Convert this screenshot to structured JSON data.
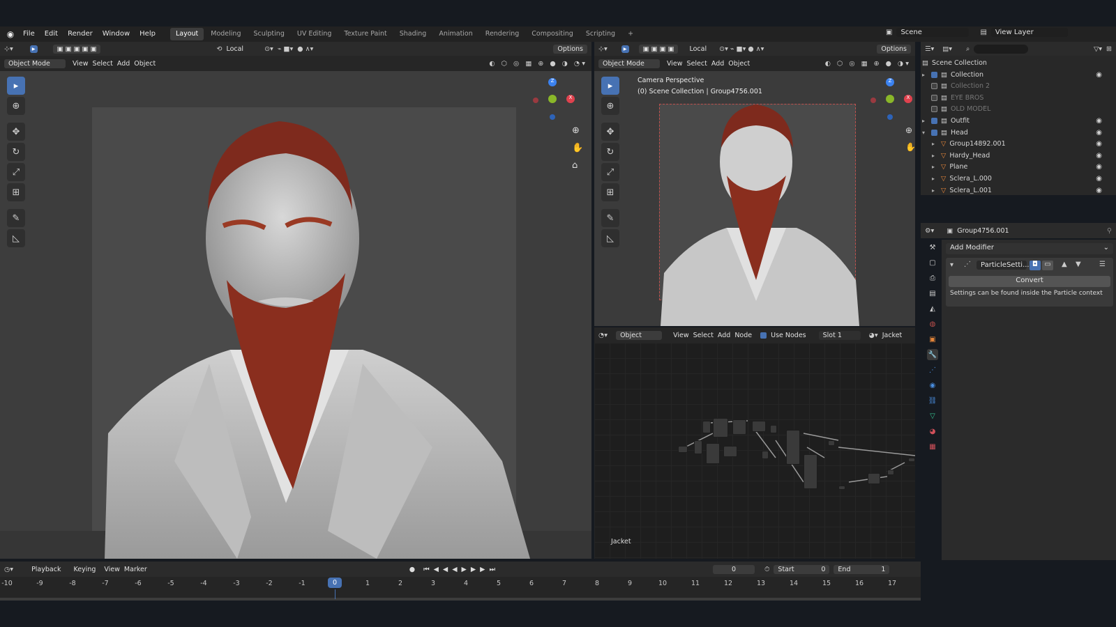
{
  "menu": {
    "file": "File",
    "edit": "Edit",
    "render": "Render",
    "window": "Window",
    "help": "Help"
  },
  "workspaces": [
    "Layout",
    "Modeling",
    "Sculpting",
    "UV Editing",
    "Texture Paint",
    "Shading",
    "Animation",
    "Rendering",
    "Compositing",
    "Scripting"
  ],
  "scene": {
    "label": "Scene",
    "view_layer": "View Layer"
  },
  "viewport_header": {
    "transform": "Local",
    "options": "Options"
  },
  "viewport_left": {
    "mode": "Object Mode",
    "view": "View",
    "select": "Select",
    "add": "Add",
    "object": "Object"
  },
  "viewport_right": {
    "mode": "Object Mode",
    "view": "View",
    "select": "Select",
    "add": "Add",
    "object": "Object",
    "transform": "Local",
    "options": "Options",
    "camera_title": "Camera Perspective",
    "camera_sub": "(0) Scene Collection | Group4756.001"
  },
  "node_editor": {
    "type": "Object",
    "view": "View",
    "select": "Select",
    "add": "Add",
    "node": "Node",
    "use_nodes": "Use Nodes",
    "slot": "Slot 1",
    "material": "Jacket",
    "footer_label": "Jacket"
  },
  "outliner": {
    "root": "Scene Collection",
    "rows": [
      {
        "name": "Collection",
        "checked": true,
        "dim": false,
        "indent": 0,
        "expander": "▸"
      },
      {
        "name": "Collection 2",
        "checked": false,
        "dim": true,
        "indent": 0,
        "expander": ""
      },
      {
        "name": "EYE BROS",
        "checked": false,
        "dim": true,
        "indent": 0,
        "expander": ""
      },
      {
        "name": "OLD MODEL",
        "checked": false,
        "dim": true,
        "indent": 0,
        "expander": ""
      },
      {
        "name": "Outfit",
        "checked": true,
        "dim": false,
        "indent": 0,
        "expander": "▸"
      },
      {
        "name": "Head",
        "checked": true,
        "dim": false,
        "indent": 0,
        "expander": "▾"
      },
      {
        "name": "Group14892.001",
        "checked": null,
        "dim": false,
        "indent": 1,
        "expander": "▸"
      },
      {
        "name": "Hardy_Head",
        "checked": null,
        "dim": false,
        "indent": 1,
        "expander": "▸"
      },
      {
        "name": "Plane",
        "checked": null,
        "dim": false,
        "indent": 1,
        "expander": "▸"
      },
      {
        "name": "Sclera_L.000",
        "checked": null,
        "dim": false,
        "indent": 1,
        "expander": "▸"
      },
      {
        "name": "Sclera_L.001",
        "checked": null,
        "dim": false,
        "indent": 1,
        "expander": "▸"
      }
    ]
  },
  "properties": {
    "object_name": "Group4756.001",
    "add_modifier": "Add Modifier",
    "modifier_name": "ParticleSetti...",
    "convert": "Convert",
    "info": "Settings can be found inside the Particle context"
  },
  "timeline": {
    "playback": "Playback",
    "keying": "Keying",
    "view": "View",
    "marker": "Marker",
    "current_frame": "0",
    "start_label": "Start",
    "start": "0",
    "end_label": "End",
    "end": "1"
  },
  "ruler_ticks": [
    "-10",
    "-9",
    "-8",
    "-7",
    "-6",
    "-5",
    "-4",
    "-3",
    "-2",
    "-1",
    "0",
    "1",
    "2",
    "3",
    "4",
    "5",
    "6",
    "7",
    "8",
    "9",
    "10",
    "11",
    "12",
    "13",
    "14",
    "15",
    "16",
    "17"
  ],
  "colors": {
    "accent": "#4772b3",
    "header": "#2b2b2b",
    "viewport": "#3a3a3a",
    "hair": "#8a2e1e",
    "x_axis": "#e0424e",
    "y_axis": "#8ab729",
    "z_axis": "#3b82f0"
  }
}
